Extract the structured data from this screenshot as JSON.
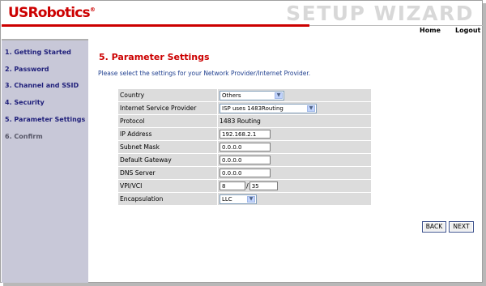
{
  "header": {
    "brand": "USRobotics",
    "brand_mark": "®",
    "wizard_title": "SETUP WIZARD"
  },
  "topnav": {
    "home": "Home",
    "logout": "Logout"
  },
  "sidebar": {
    "items": [
      {
        "label": "1. Getting Started",
        "active": true
      },
      {
        "label": "2. Password",
        "active": true
      },
      {
        "label": "3. Channel and SSID",
        "active": true
      },
      {
        "label": "4. Security",
        "active": true
      },
      {
        "label": "5. Parameter Settings",
        "active": true
      },
      {
        "label": "6. Confirm",
        "active": false
      }
    ]
  },
  "main": {
    "title": "5. Parameter Settings",
    "intro": "Please select the settings for your Network Provider/Internet Provider.",
    "form": {
      "country_label": "Country",
      "country_value": "Others",
      "isp_label": "Internet Service Provider",
      "isp_value": "ISP uses 1483Routing",
      "protocol_label": "Protocol",
      "protocol_value": "1483 Routing",
      "ip_label": "IP Address",
      "ip_value": "192.168.2.1",
      "subnet_label": "Subnet Mask",
      "subnet_value": "0.0.0.0",
      "gateway_label": "Default Gateway",
      "gateway_value": "0.0.0.0",
      "dns_label": "DNS Server",
      "dns_value": "0.0.0.0",
      "vpivci_label": "VPI/VCI",
      "vpi_value": "8",
      "vci_separator": "/",
      "vci_value": "35",
      "encap_label": "Encapsulation",
      "encap_value": "LLC"
    },
    "buttons": {
      "back": "BACK",
      "next": "NEXT"
    }
  },
  "colors": {
    "brand_red": "#cc0000",
    "sidebar_bg": "#c8c8d8",
    "nav_text": "#1f1f7a",
    "intro_text": "#1f3f8f"
  }
}
